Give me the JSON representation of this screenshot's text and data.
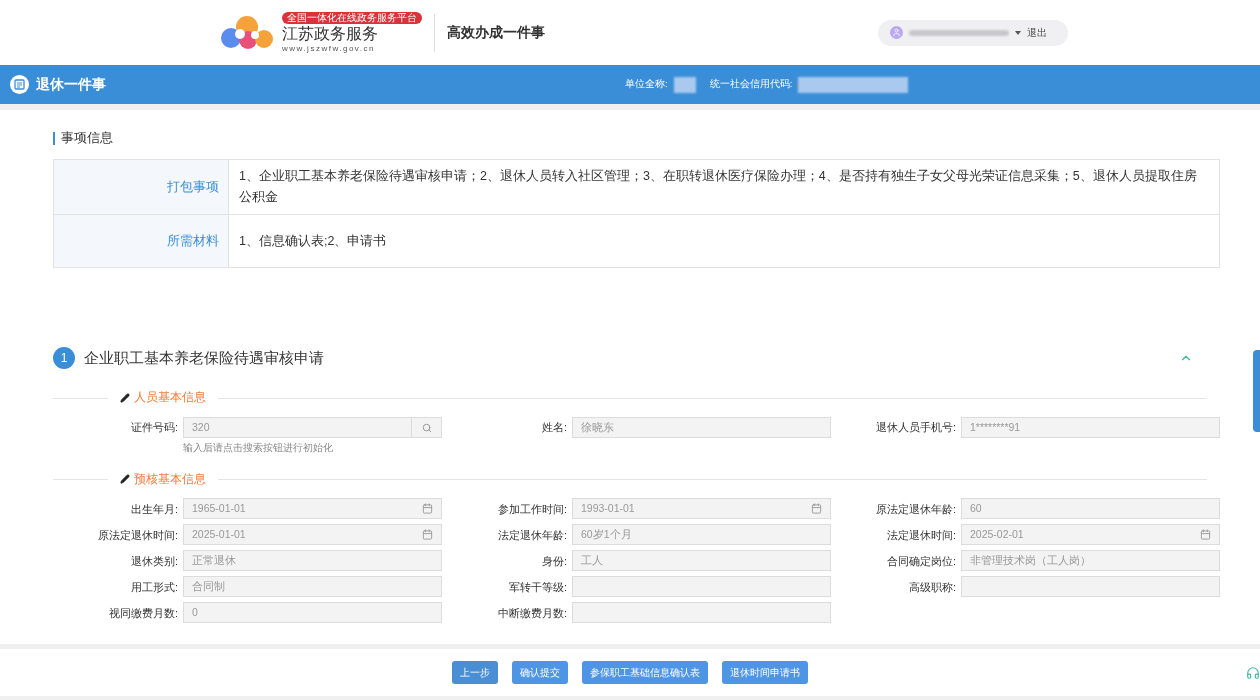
{
  "header": {
    "badge": "全国一体化在线政务服务平台",
    "site_name": "江苏政务服务",
    "site_url": "www.jszwfw.gov.cn",
    "app_title": "高效办成一件事",
    "logout": "退出"
  },
  "title_bar": {
    "title": "退休一件事",
    "unit_label": "单位全称:",
    "credit_label": "统一社会信用代码:"
  },
  "matter_info": {
    "title": "事项信息",
    "rows": [
      {
        "label": "打包事项",
        "value": "1、企业职工基本养老保险待遇审核申请；2、退休人员转入社区管理；3、在职转退休医疗保险办理；4、是否持有独生子女父母光荣证信息采集；5、退休人员提取住房公积金"
      },
      {
        "label": "所需材料",
        "value": "1、信息确认表;2、申请书"
      }
    ]
  },
  "section": {
    "number": "1",
    "title": "企业职工基本养老保险待遇审核申请",
    "expanded": true,
    "groups": [
      {
        "title": "人员基本信息",
        "hint": "输入后请点击搜索按钮进行初始化",
        "fields": [
          {
            "label": "证件号码:",
            "value": "320",
            "kind": "search"
          },
          {
            "label": "姓名:",
            "value": "徐晓东",
            "kind": "text"
          },
          {
            "label": "退休人员手机号:",
            "value": "1********91",
            "kind": "text"
          }
        ]
      },
      {
        "title": "预核基本信息",
        "fields": [
          {
            "label": "出生年月:",
            "value": "1965-01-01",
            "kind": "date"
          },
          {
            "label": "参加工作时间:",
            "value": "1993-01-01",
            "kind": "date"
          },
          {
            "label": "原法定退休年龄:",
            "value": "60",
            "kind": "text"
          },
          {
            "label": "原法定退休时间:",
            "value": "2025-01-01",
            "kind": "date"
          },
          {
            "label": "法定退休年龄:",
            "value": "60岁1个月",
            "kind": "text"
          },
          {
            "label": "法定退休时间:",
            "value": "2025-02-01",
            "kind": "date"
          },
          {
            "label": "退休类别:",
            "value": "正常退休",
            "kind": "text"
          },
          {
            "label": "身份:",
            "value": "工人",
            "kind": "text"
          },
          {
            "label": "合同确定岗位:",
            "value": "非管理技术岗（工人岗）",
            "kind": "text"
          },
          {
            "label": "用工形式:",
            "value": "合同制",
            "kind": "text"
          },
          {
            "label": "军转干等级:",
            "kind": "text"
          },
          {
            "label": "高级职称:",
            "kind": "text"
          },
          {
            "label": "视同缴费月数:",
            "value": "0",
            "kind": "text"
          },
          {
            "label": "中断缴费月数:",
            "kind": "text"
          }
        ]
      }
    ]
  },
  "buttons": [
    "上一步",
    "确认提交",
    "参保职工基础信息确认表",
    "退休时间申请书"
  ]
}
